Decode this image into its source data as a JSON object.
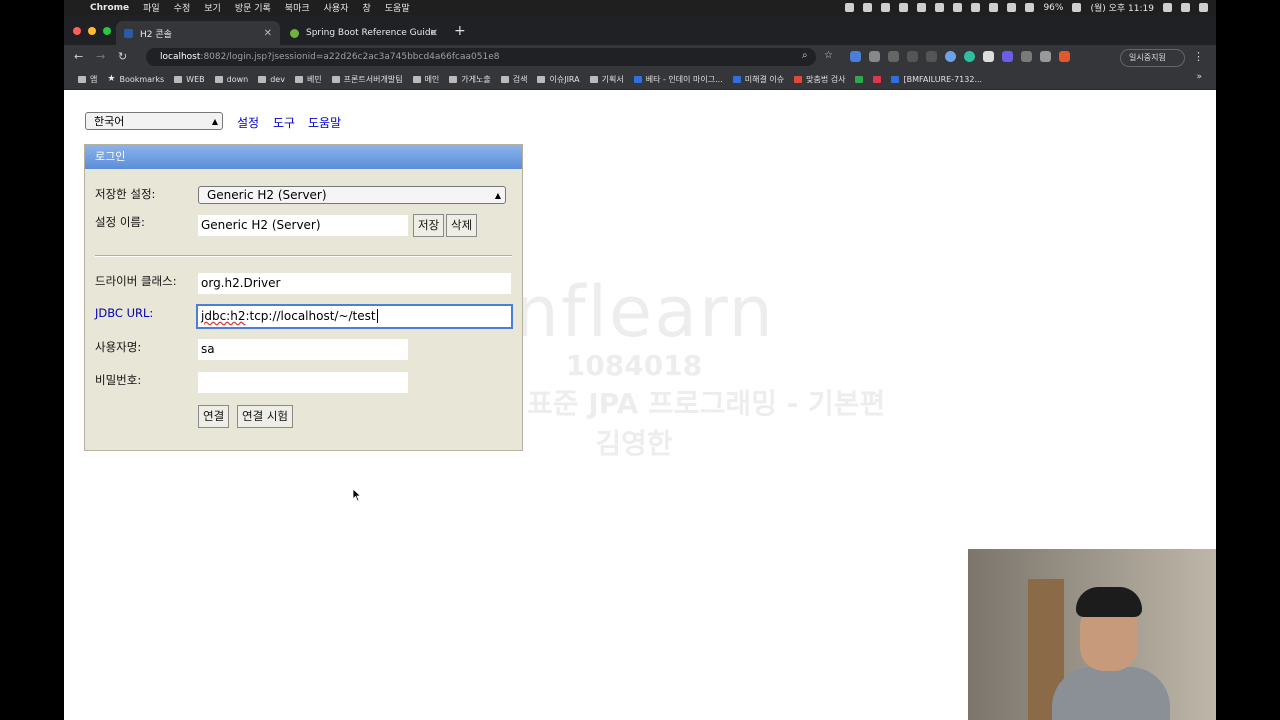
{
  "menubar": {
    "app": "Chrome",
    "items": [
      "파일",
      "수정",
      "보기",
      "방문 기록",
      "북마크",
      "사용자",
      "창",
      "도움말"
    ],
    "battery": "96%",
    "clock": "(월) 오후 11:19"
  },
  "tabs": [
    {
      "title": "H2 콘솔",
      "active": true
    },
    {
      "title": "Spring Boot Reference Guide",
      "active": false
    }
  ],
  "address": {
    "host": "localhost",
    "rest": ":8082/login.jsp?jsessionid=a22d26c2ac3a745bbcd4a66fcaa051e8",
    "profile": "일시중지됨"
  },
  "bookmarks": [
    "앱",
    "Bookmarks",
    "WEB",
    "down",
    "dev",
    "베민",
    "프론트서버개발팀",
    "메인",
    "가게노출",
    "검색",
    "이슈JIRA",
    "기획서",
    "베타 - 인데이 마이그...",
    "미해결 이슈",
    "맞춤법 검사",
    "[BMFAILURE-7132..."
  ],
  "toplinks": {
    "language": "한국어",
    "settings": "설정",
    "tools": "도구",
    "help": "도움말"
  },
  "login": {
    "header": "로그인",
    "saved_settings_label": "저장한 설정:",
    "saved_settings_value": "Generic H2 (Server)",
    "setting_name_label": "설정 이름:",
    "setting_name_value": "Generic H2 (Server)",
    "save_button": "저장",
    "delete_button": "삭제",
    "driver_label": "드라이버 클래스:",
    "driver_value": "org.h2.Driver",
    "jdbc_label": "JDBC URL:",
    "jdbc_prefix": "jdbc:h2",
    "jdbc_rest": ":tcp://localhost/~/test",
    "user_label": "사용자명:",
    "user_value": "sa",
    "password_label": "비밀번호:",
    "password_value": "",
    "connect_button": "연결",
    "test_button": "연결 시험"
  },
  "watermark": {
    "logo": "inflearn",
    "number": "1084018",
    "course": "자바 ORM 표준 JPA 프로그래밍 - 기본편",
    "author": "김영한"
  }
}
